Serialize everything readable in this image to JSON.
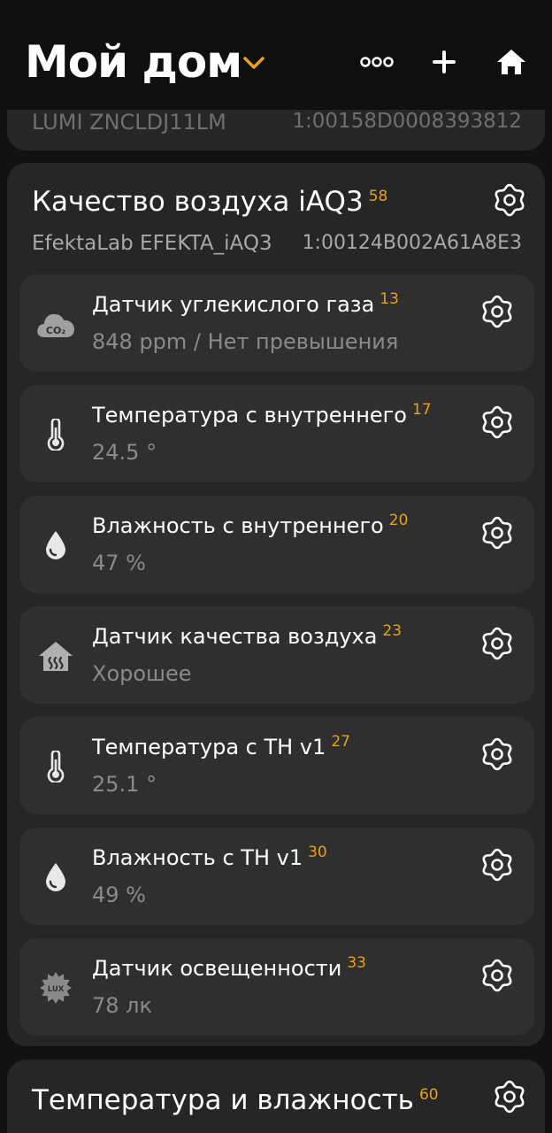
{
  "header": {
    "title": "Мой дом",
    "accent_color": "#e8a11b",
    "actions": [
      "more-icon",
      "add-icon",
      "home-icon"
    ]
  },
  "previous_card": {
    "model": "LUMI ZNCLDJ11LM",
    "address": "1:00158D0008393812"
  },
  "devices": [
    {
      "title": "Качество воздуха iAQ3",
      "number": "58",
      "model": "EfektaLab EFEKTA_iAQ3",
      "address": "1:00124B002A61A8E3",
      "sensors": [
        {
          "label": "Датчик углекислого газа",
          "number": "13",
          "value": "848 ppm / Нет превышения",
          "icon": "co2-cloud-icon"
        },
        {
          "label": "Температура с внутреннего",
          "number": "17",
          "value": "24.5 °",
          "icon": "thermometer-icon"
        },
        {
          "label": "Влажность с внутреннего",
          "number": "20",
          "value": "47 %",
          "icon": "water-drop-icon"
        },
        {
          "label": "Датчик качества воздуха",
          "number": "23",
          "value": "Хорошее",
          "icon": "house-air-icon"
        },
        {
          "label": "Температура с TH v1",
          "number": "27",
          "value": "25.1 °",
          "icon": "thermometer-icon"
        },
        {
          "label": "Влажность с TH v1",
          "number": "30",
          "value": "49 %",
          "icon": "water-drop-icon"
        },
        {
          "label": "Датчик освещенности",
          "number": "33",
          "value": "78 лк",
          "icon": "lux-sun-icon"
        }
      ]
    },
    {
      "title": "Температура и влажность",
      "number": "60"
    }
  ]
}
